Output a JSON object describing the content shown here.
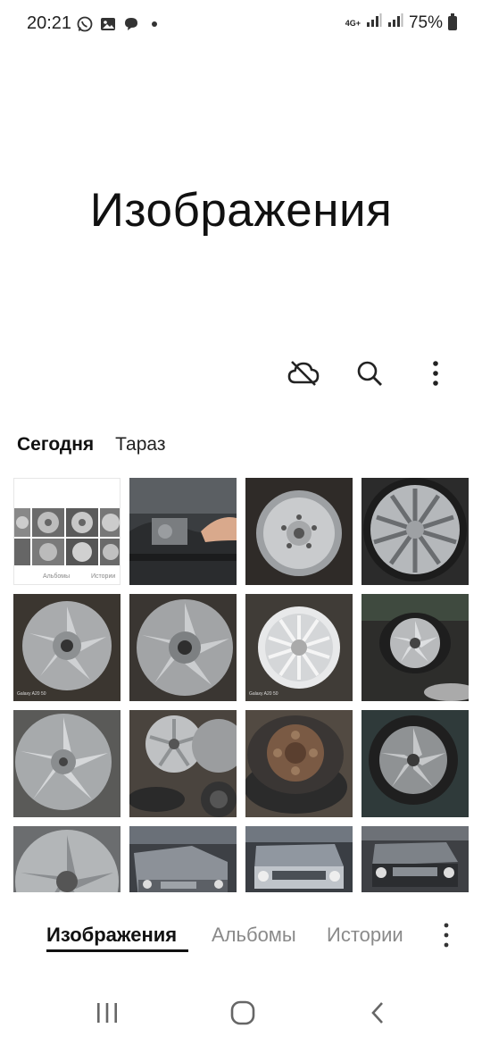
{
  "status_bar": {
    "time": "20:21",
    "network": "4G+",
    "battery": "75%",
    "left_icons": [
      "whatsapp-icon",
      "gallery-icon",
      "chat-icon",
      "dot-icon"
    ]
  },
  "header": {
    "title": "Изображения"
  },
  "toolbar": {
    "icons": [
      "cloud-off-icon",
      "search-icon",
      "more-vert-icon"
    ]
  },
  "section": {
    "date": "Сегодня",
    "location": "Тараз"
  },
  "grid": {
    "screenshot_tabs": [
      "Альбомы",
      "Истории"
    ],
    "captions": [
      "Galaxy A20 50",
      "Galaxy A20 50"
    ]
  },
  "tabs": {
    "items": [
      "Изображения",
      "Альбомы",
      "Истории"
    ],
    "active": "Изображения"
  },
  "navbar": {
    "icons": [
      "recent-apps-icon",
      "home-icon",
      "back-icon"
    ]
  },
  "colors": {
    "background": "#ffffff",
    "text": "#111111",
    "inactive_tab": "#8a8a8a"
  }
}
